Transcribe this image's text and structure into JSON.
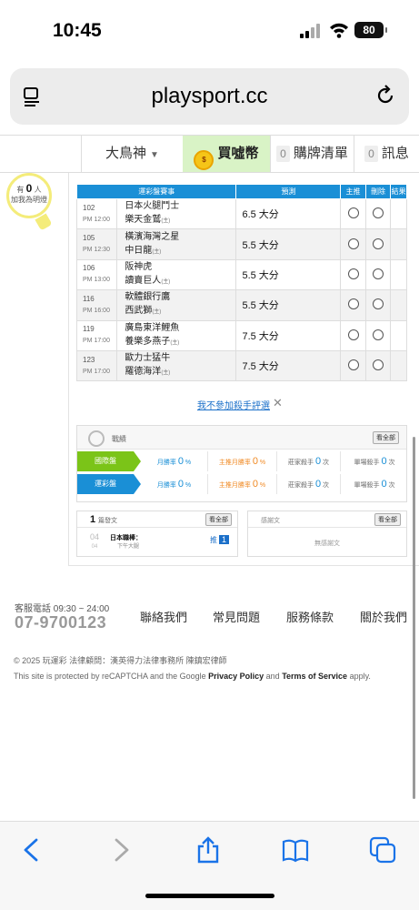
{
  "status_bar": {
    "time": "10:45",
    "battery": "80"
  },
  "browser": {
    "url": "playsport.cc"
  },
  "nav": {
    "user": "大鳥神",
    "buy": "買噓幣",
    "cart_count": "0",
    "cart": "購牌清單",
    "msg_count": "0",
    "msg": "訊息"
  },
  "tracker": {
    "prefix": "有",
    "count": "0",
    "unit": "人",
    "line2": "加我為明燈"
  },
  "table": {
    "headers": [
      "運彩盤賽事",
      "預測",
      "主推",
      "刪除",
      "結果"
    ],
    "rows": [
      {
        "no": "102",
        "time": "PM 12:00",
        "team1": "日本火腿鬥士",
        "team2": "樂天金鷲",
        "mark": "(主)",
        "pred": "6.5 大分"
      },
      {
        "no": "105",
        "time": "PM 12:30",
        "team1": "橫濱海灣之星",
        "team2": "中日龍",
        "mark": "(主)",
        "pred": "5.5 大分"
      },
      {
        "no": "106",
        "time": "PM 13:00",
        "team1": "阪神虎",
        "team2": "讀賣巨人",
        "mark": "(主)",
        "pred": "5.5 大分"
      },
      {
        "no": "116",
        "time": "PM 16:00",
        "team1": "軟體銀行鷹",
        "team2": "西武獅",
        "mark": "(主)",
        "pred": "5.5 大分"
      },
      {
        "no": "119",
        "time": "PM 17:00",
        "team1": "廣島東洋鯉魚",
        "team2": "養樂多燕子",
        "mark": "(主)",
        "pred": "7.5 大分"
      },
      {
        "no": "123",
        "time": "PM 17:00",
        "team1": "歐力士猛牛",
        "team2": "羅德海洋",
        "mark": "(主)",
        "pred": "7.5 大分"
      }
    ]
  },
  "optout": {
    "text": "我不參加殺手評選",
    "close": "✕"
  },
  "record": {
    "title": "戰績",
    "view_all": "看全部",
    "rows": [
      {
        "tag": "國際盤",
        "monthly_label": "月勝率",
        "monthly": "0",
        "main_label": "主推月勝率",
        "main": "0",
        "killer_label": "莊家殺手",
        "killer": "0",
        "unit": "次",
        "single_label": "單場殺手",
        "single": "0"
      },
      {
        "tag": "運彩盤",
        "monthly_label": "月勝率",
        "monthly": "0",
        "main_label": "主推月勝率",
        "main": "0",
        "killer_label": "莊家殺手",
        "killer": "0",
        "unit": "次",
        "single_label": "單場殺手",
        "single": "0"
      }
    ],
    "pct": "%"
  },
  "posts": {
    "count": "1",
    "label": "篇發文",
    "view_all": "看全部",
    "date_month": "04",
    "date_day": "04",
    "title": "日本職棒：",
    "subtitle": "下午大腿",
    "push_label": "推",
    "push_count": "1"
  },
  "thanks": {
    "label": "感謝文",
    "view_all": "看全部",
    "empty": "無感謝文"
  },
  "footer": {
    "cs_label": "客服電話 09:30 ~ 24:00",
    "phone": "07-9700123",
    "links": [
      "聯絡我們",
      "常見問題",
      "服務條款",
      "關於我們"
    ],
    "copyright": "© 2025 玩運彩 法律顧問：漢英得力法律事務所 陳鎮宏律師",
    "recaptcha_pre": "This site is protected by reCAPTCHA and the Google ",
    "privacy": "Privacy Policy",
    "and": " and ",
    "terms": "Terms of Service",
    "apply": " apply."
  }
}
